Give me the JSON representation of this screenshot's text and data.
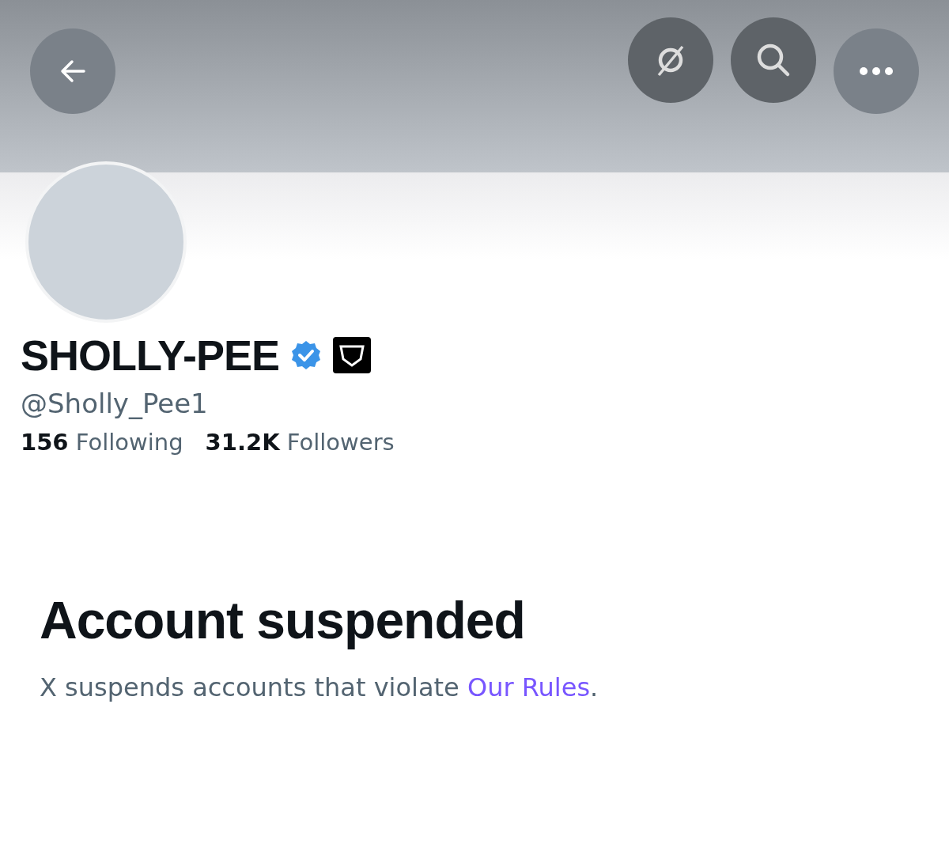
{
  "profile": {
    "name": "SHOLLY-PEE",
    "verified": true,
    "handle": "@Sholly_Pee1",
    "stats": [
      {
        "count": "156",
        "label": "Following"
      },
      {
        "count": "31.2K",
        "label": "Followers"
      }
    ]
  },
  "notice": {
    "title": "Account suspended",
    "text": "X suspends accounts that violate ",
    "link": "Our Rules",
    "after": "."
  }
}
